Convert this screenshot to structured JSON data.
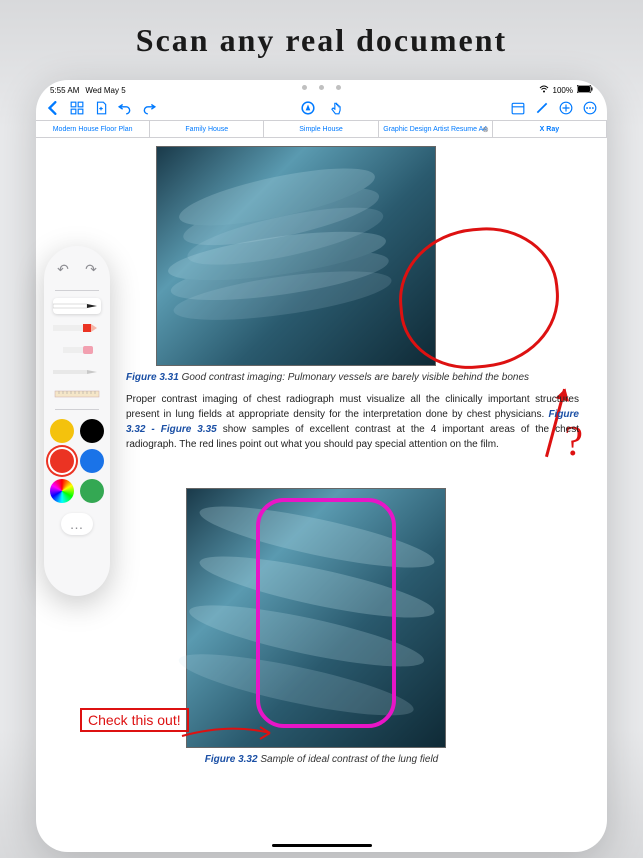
{
  "headline": "Scan any real document",
  "status": {
    "time": "5:55 AM",
    "date": "Wed May 5",
    "wifi": true,
    "battery": "100%"
  },
  "toolbar": {
    "back": "Back",
    "grid": "Thumbnails",
    "add_page": "Add page",
    "undo": "Undo",
    "redo": "Redo",
    "pen_mode": "Pen",
    "touch_mode": "Touch",
    "calendar": "Calendar",
    "edit": "Edit",
    "add": "Add",
    "more": "More"
  },
  "tabs": [
    {
      "label": "Modern House Floor Plan",
      "closable": false
    },
    {
      "label": "Family House",
      "closable": false
    },
    {
      "label": "Simple House",
      "closable": false
    },
    {
      "label": "Graphic Design Artist Resume A4",
      "closable": true
    },
    {
      "label": "X Ray",
      "closable": false,
      "active": true
    }
  ],
  "doc": {
    "fig1_label": "Figure 3.31",
    "fig1_caption": " Good contrast imaging: Pulmonary vessels are barely visible behind the bones",
    "body1": "Proper contrast imaging of chest radiograph must visualize all the clinically important structures present in lung fields at appropriate density for the interpretation done by chest physicians. ",
    "body_figref": "Figure 3.32 - Figure 3.35",
    "body2": " show samples of excellent contrast at the 4 important areas of the chest radiograph. The red lines point out what you should pay special attention on the film.",
    "checkout": "Check this out!",
    "question_mark": "?",
    "fig2_label": "Figure 3.32",
    "fig2_caption": " Sample of ideal contrast of the lung field"
  },
  "palette": {
    "tools": {
      "pen": "Pen",
      "highlighter": "Highlighter",
      "eraser": "Eraser",
      "pencil": "Pencil",
      "ruler": "Ruler"
    },
    "colors": {
      "yellow": "#f4c20d",
      "black": "#000000",
      "red": "#eb3323",
      "blue": "#1a73e8",
      "rainbow": "multicolor",
      "green": "#34a853"
    },
    "more": "…"
  }
}
